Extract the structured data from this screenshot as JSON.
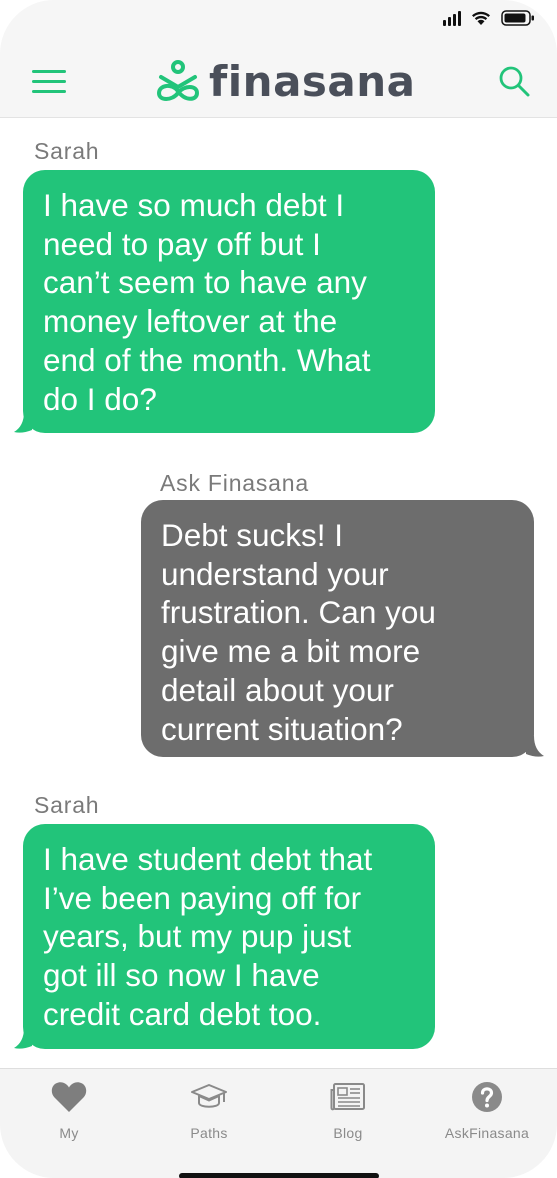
{
  "brand": {
    "name": "finasana",
    "accent_color": "#22c47a"
  },
  "status_bar": {
    "icons": [
      "signal-icon",
      "wifi-icon",
      "battery-icon"
    ]
  },
  "header": {
    "left_icon": "menu-icon",
    "right_icon": "search-icon"
  },
  "chat": {
    "messages": [
      {
        "sender": "Sarah",
        "side": "left",
        "color": "#22c47a",
        "lines": [
          "I have so much debt I",
          "need to pay off but I",
          "can’t seem to have any",
          "money leftover at the",
          "end of the month. What",
          "do I do?"
        ]
      },
      {
        "sender": "Ask Finasana",
        "side": "right",
        "color": "#6d6d6d",
        "lines": [
          "Debt sucks! I",
          "understand your",
          "frustration. Can you",
          "give me a bit more",
          "detail about your",
          "current situation?"
        ]
      },
      {
        "sender": "Sarah",
        "side": "left",
        "color": "#22c47a",
        "lines": [
          "I have student debt that",
          "I’ve been paying off for",
          "years, but my pup just",
          "got ill so now I have",
          "credit card debt too."
        ]
      }
    ]
  },
  "tabbar": {
    "tabs": [
      {
        "label": "My",
        "icon": "heart-icon"
      },
      {
        "label": "Paths",
        "icon": "graduation-cap-icon"
      },
      {
        "label": "Blog",
        "icon": "newspaper-icon"
      },
      {
        "label": "AskFinasana",
        "icon": "question-icon"
      }
    ]
  }
}
